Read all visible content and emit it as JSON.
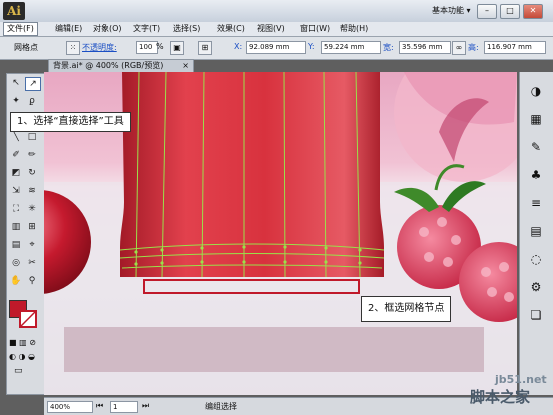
{
  "app": {
    "logo": "Ai"
  },
  "menu": [
    "文件(F)",
    "编辑(E)",
    "对象(O)",
    "文字(T)",
    "选择(S)",
    "效果(C)",
    "视图(V)",
    "窗口(W)",
    "帮助(H)"
  ],
  "workspace": "基本功能",
  "window_buttons": [
    "–",
    "□",
    "✕"
  ],
  "control_bar": {
    "label": "网格点",
    "opacity_label": "不透明度:",
    "opacity_value": "100",
    "opacity_unit": "%",
    "x_label": "X:",
    "x_value": "92.089 mm",
    "y_label": "Y:",
    "y_value": "59.224 mm",
    "w_label": "宽:",
    "w_value": "35.596 mm",
    "h_label": "高:",
    "h_value": "116.907 mm"
  },
  "doc_tab": "背景.ai* @ 400% (RGB/预览)",
  "callouts": {
    "step1": "1、选择“直接选择”工具",
    "step2": "2、框选网格节点"
  },
  "status": {
    "zoom": "400%",
    "page": "1",
    "tool": "编组选择"
  },
  "watermark": {
    "site": "jb51.net",
    "name": "脚本之家"
  },
  "colors": {
    "jar_red": "#d8323e",
    "mesh_line": "#9be04a",
    "selection_box": "#c0192a",
    "fill_swatch": "#c0192a"
  },
  "icons": [
    "arrow-icon",
    "direct-select-icon",
    "magic-wand-icon",
    "lasso-icon",
    "pen-icon",
    "type-icon",
    "line-icon",
    "rect-icon",
    "brush-icon",
    "pencil-icon",
    "eraser-icon",
    "rotate-icon",
    "scale-icon",
    "warp-icon",
    "free-transform-icon",
    "symbol-sprayer-icon",
    "graph-icon",
    "mesh-icon",
    "gradient-icon",
    "eyedropper-icon",
    "blend-icon",
    "slice-icon",
    "hand-icon",
    "zoom-icon"
  ]
}
